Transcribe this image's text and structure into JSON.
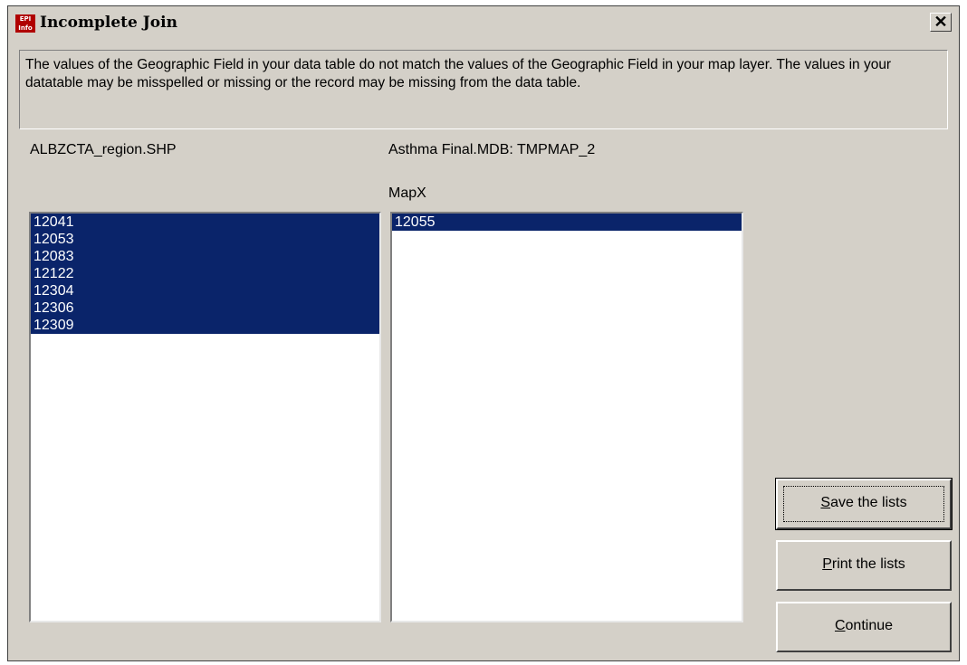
{
  "window": {
    "title": "Incomplete Join",
    "icon_text": "EPI Info",
    "close_symbol": "✕"
  },
  "message": "The values of the Geographic Field in your data table do not match the values of the Geographic Field in your map layer. The values in your datatable may be misspelled or missing or the record may be missing from the data table.",
  "left_list": {
    "title": "ALBZCTA_region.SHP",
    "items": [
      "12041",
      "12053",
      "12083",
      "12122",
      "12304",
      "12306",
      "12309"
    ]
  },
  "right_list": {
    "title": "Asthma Final.MDB: TMPMAP_2",
    "field_label": "MapX",
    "items": [
      "12055"
    ]
  },
  "buttons": {
    "save": {
      "mnemonic": "S",
      "rest": "ave the lists"
    },
    "print": {
      "mnemonic": "P",
      "rest": "rint the lists"
    },
    "continue": {
      "mnemonic": "C",
      "rest": "ontinue"
    }
  },
  "colors": {
    "dialog_bg": "#d4d0c8",
    "selection": "#0a246a"
  }
}
